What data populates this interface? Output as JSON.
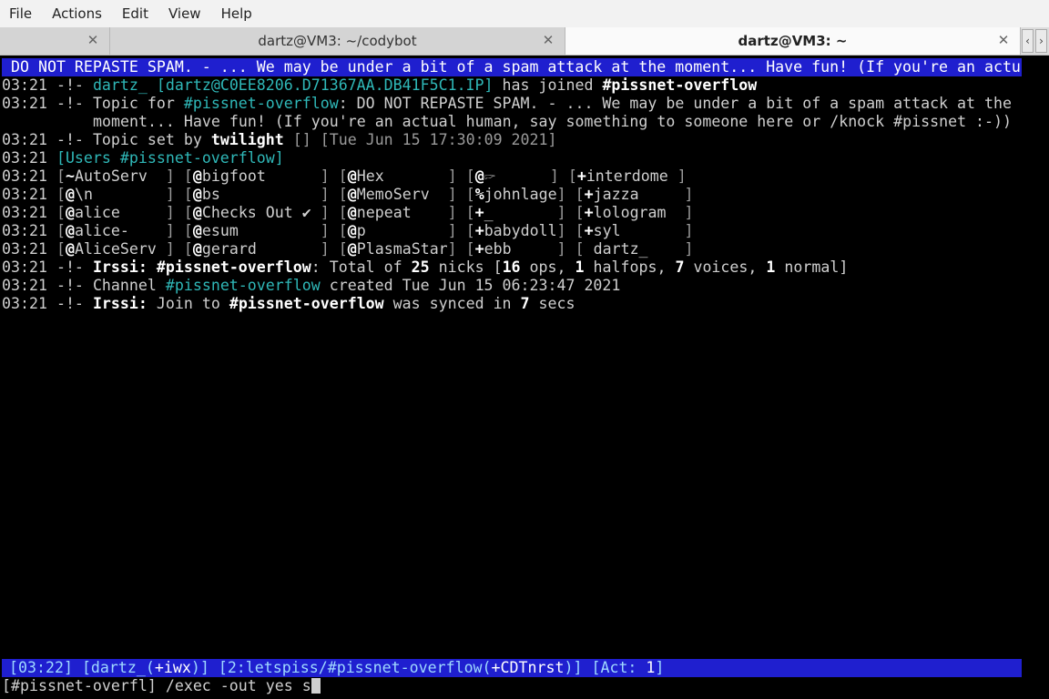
{
  "menu": [
    "File",
    "Actions",
    "Edit",
    "View",
    "Help"
  ],
  "tabs": [
    {
      "label": "",
      "close": "✕"
    },
    {
      "label": "dartz@VM3: ~/codybot",
      "close": "✕"
    },
    {
      "label": "dartz@VM3: ~",
      "close": "✕"
    }
  ],
  "tab_scroll": {
    "left": "‹",
    "right": "›"
  },
  "topic_bar": "DO NOT REPASTE SPAM. - ... We may be under a bit of a spam attack at the moment... Have fun! (If you're an actu",
  "log": {
    "join": {
      "ts": "03:21",
      "marker": "-!-",
      "nick": "dartz_",
      "host": "[dartz@C0EE8206.D71367AA.DB41F5C1.IP]",
      "text": "has joined",
      "channel": "#pissnet-overflow"
    },
    "topic1": {
      "ts": "03:21",
      "marker": "-!-",
      "pre": "Topic for",
      "channel": "#pissnet-overflow",
      "text": ": DO NOT REPASTE SPAM. - ... We may be under a bit of a spam attack at the"
    },
    "topic2": "moment... Have fun! (If you're an actual human, say something to someone here or /knock #pissnet :-))",
    "topicset": {
      "ts": "03:21",
      "marker": "-!-",
      "pre": "Topic set by",
      "nick": "twilight",
      "brackets": "[]",
      "date": "[Tue Jun 15 17:30:09 2021]"
    },
    "users_header": {
      "ts": "03:21",
      "label": "[Users",
      "channel": "#pissnet-overflow",
      "close": "]"
    },
    "user_rows": [
      {
        "ts": "03:21",
        "cells": [
          [
            "~",
            "AutoServ"
          ],
          [
            "@",
            "bigfoot"
          ],
          [
            "@",
            "Hex"
          ],
          [
            "@",
            "🖙"
          ],
          [
            "+",
            "interdome"
          ]
        ]
      },
      {
        "ts": "03:21",
        "cells": [
          [
            "@",
            "\\n"
          ],
          [
            "@",
            "bs"
          ],
          [
            "@",
            "MemoServ"
          ],
          [
            "%",
            "johnlage"
          ],
          [
            "+",
            "jazza"
          ]
        ]
      },
      {
        "ts": "03:21",
        "cells": [
          [
            "@",
            "alice"
          ],
          [
            "@",
            "Checks Out ✔"
          ],
          [
            "@",
            "nepeat"
          ],
          [
            "+",
            "_"
          ],
          [
            "+",
            "lologram"
          ]
        ]
      },
      {
        "ts": "03:21",
        "cells": [
          [
            "@",
            "alice-"
          ],
          [
            "@",
            "esum"
          ],
          [
            "@",
            "p"
          ],
          [
            "+",
            "babydoll"
          ],
          [
            "+",
            "syl"
          ]
        ]
      },
      {
        "ts": "03:21",
        "cells": [
          [
            "@",
            "AliceServ"
          ],
          [
            "@",
            "gerard"
          ],
          [
            "@",
            "PlasmaStar"
          ],
          [
            "+",
            "ebb"
          ],
          [
            " ",
            "dartz_"
          ]
        ]
      }
    ],
    "total": {
      "ts": "03:21",
      "marker": "-!-",
      "irssi": "Irssi:",
      "channel": "#pissnet-overflow",
      "text1": ": Total of",
      "nicks": "25",
      "text2": "nicks [",
      "ops": "16",
      "text3": "ops,",
      "halfops": "1",
      "text4": "halfops,",
      "voices": "7",
      "text5": "voices,",
      "normal": "1",
      "text6": "normal]"
    },
    "created": {
      "ts": "03:21",
      "marker": "-!-",
      "pre": "Channel",
      "channel": "#pissnet-overflow",
      "text": "created Tue Jun 15 06:23:47 2021"
    },
    "synced": {
      "ts": "03:21",
      "marker": "-!-",
      "irssi": "Irssi:",
      "pre": "Join to",
      "channel": "#pissnet-overflow",
      "mid": "was synced in",
      "secs": "7",
      "post": "secs"
    }
  },
  "statusbar": {
    "time": "[03:22]",
    "nick_open": "[dartz_(",
    "modes": "+iwx",
    "nick_close": ")]",
    "window_open": "[2:letspiss/#pissnet-overflow(",
    "chanmodes": "+CDTnrst",
    "window_close": ")]",
    "act_open": "[Act:",
    "act": "1",
    "act_close": "]"
  },
  "input": {
    "prompt": "[#pissnet-overfl]",
    "text": "/exec -out yes s"
  },
  "colors": {
    "topic_bar": "#1f1fcf",
    "status_bar": "#1f1fcf",
    "cyan": "#2fb8b8",
    "background": "#000000"
  }
}
